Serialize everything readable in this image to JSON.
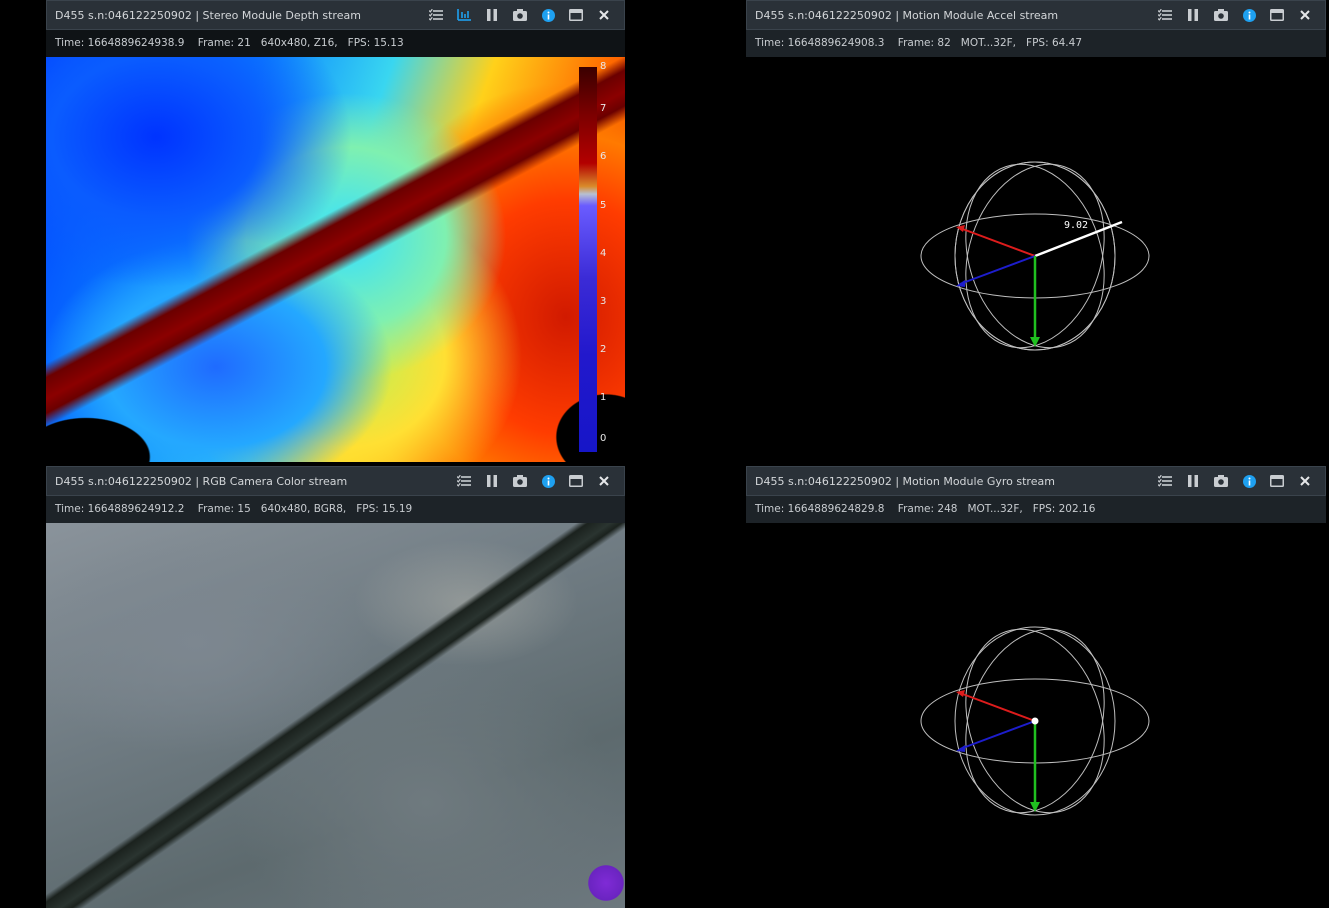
{
  "depth": {
    "title": "D455 s.n:046122250902 | Stereo Module Depth stream",
    "time": "Time: 1664889624938.9",
    "frame": "Frame: 21",
    "format": "640x480,  Z16,",
    "fps": "FPS:  15.13",
    "colorbar_ticks": [
      "8",
      "7",
      "6",
      "5",
      "4",
      "3",
      "2",
      "1",
      "0"
    ]
  },
  "accel": {
    "title": "D455 s.n:046122250902 | Motion Module Accel stream",
    "time": "Time: 1664889624908.3",
    "frame": "Frame: 82",
    "format": "MOT...32F,",
    "fps": "FPS:  64.47",
    "magnitude": "9.02"
  },
  "color": {
    "title": "D455 s.n:046122250902 | RGB Camera Color stream",
    "time": "Time: 1664889624912.2",
    "frame": "Frame: 15",
    "format": "640x480,  BGR8,",
    "fps": "FPS:  15.19"
  },
  "gyro": {
    "title": "D455 s.n:046122250902 | Motion Module Gyro stream",
    "time": "Time: 1664889624829.8",
    "frame": "Frame: 248",
    "format": "MOT...32F,",
    "fps": "FPS:  202.16"
  },
  "icons": {
    "options": "options-list-icon",
    "metadata": "chart-icon",
    "pause": "pause-icon",
    "snapshot": "camera-icon",
    "info": "info-icon",
    "minimize": "window-icon",
    "close": "close-icon"
  },
  "colors": {
    "accent": "#1ea0f0",
    "titlebar": "#2a3138",
    "infobar": "#1d2328",
    "axis_x": "#dd1c1c",
    "axis_y": "#20c020",
    "axis_z": "#1d1dcc"
  }
}
